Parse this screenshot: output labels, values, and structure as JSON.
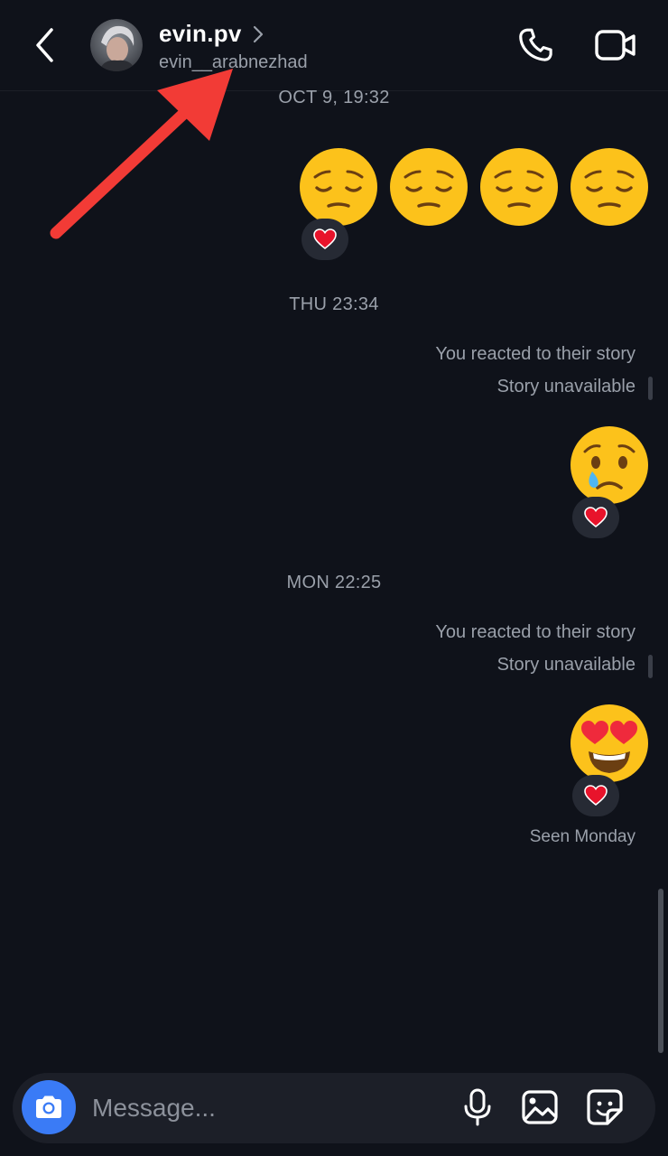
{
  "header": {
    "name": "evin.pv",
    "username": "evin__arabnezhad",
    "icons": {
      "back": "chevron-left-icon",
      "profile_chevron": "chevron-right-icon",
      "call": "phone-icon",
      "video": "video-camera-icon"
    }
  },
  "thread": {
    "groups": [
      {
        "timestamp": "OCT 9, 19:32",
        "emojis": [
          "😔",
          "😔",
          "😔",
          "😔"
        ],
        "reaction": "❤️"
      },
      {
        "timestamp": "THU 23:34",
        "story_note": "You reacted to their story",
        "story_status": "Story unavailable",
        "emojis": [
          "😢"
        ],
        "reaction": "❤️"
      },
      {
        "timestamp": "MON 22:25",
        "story_note": "You reacted to their story",
        "story_status": "Story unavailable",
        "emojis": [
          "😍"
        ],
        "reaction": "❤️"
      }
    ],
    "seen": "Seen Monday"
  },
  "composer": {
    "placeholder": "Message...",
    "icons": {
      "camera": "camera-icon",
      "mic": "microphone-icon",
      "gallery": "image-gallery-icon",
      "sticker": "sticker-icon"
    }
  },
  "colors": {
    "background": "#0f121a",
    "camera_button": "#3a7bf6",
    "annotation_arrow": "#f23b36",
    "reaction_bubble": "#262a34"
  }
}
